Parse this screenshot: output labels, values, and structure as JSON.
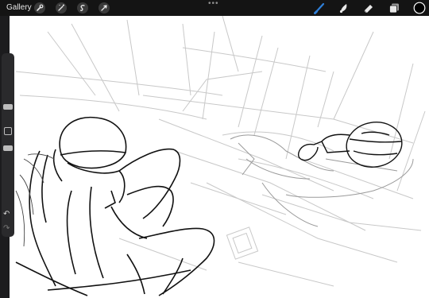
{
  "topbar": {
    "gallery_label": "Gallery",
    "dots": "•••",
    "left_tools": [
      "wrench-icon",
      "adjustments-icon",
      "selection-icon",
      "transform-icon"
    ],
    "right_tools": [
      "brush-icon",
      "smudge-icon",
      "eraser-icon",
      "layers-icon",
      "color-swatch"
    ],
    "active_tool": "brush-icon",
    "accent_color": "#2f7fd8",
    "current_color": "#000000"
  },
  "sidebar": {
    "undo_icon": "↶",
    "redo_icon": "↷"
  }
}
